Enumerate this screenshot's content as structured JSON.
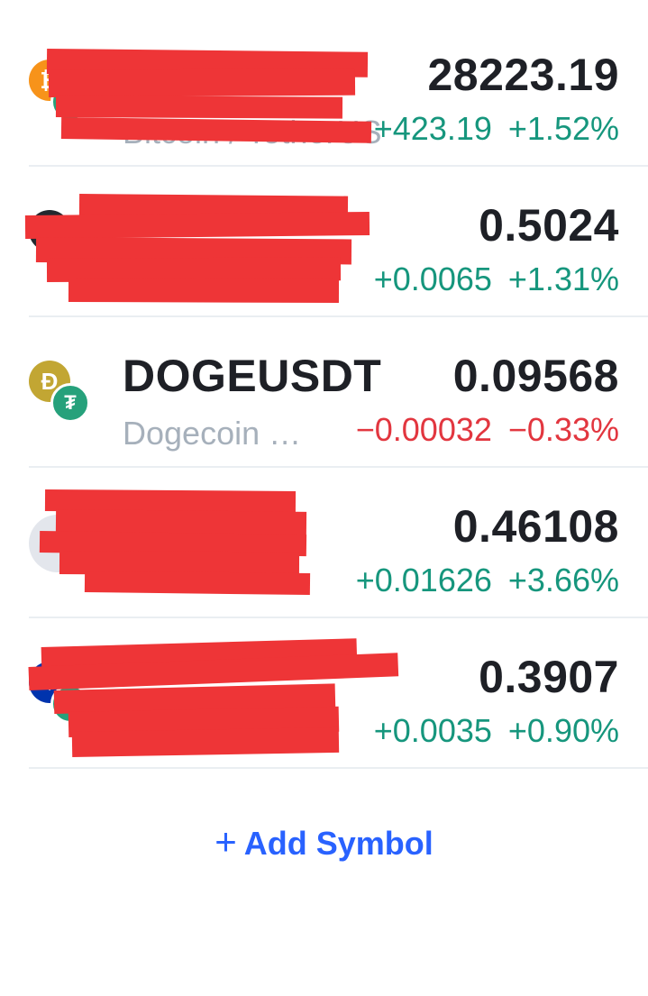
{
  "watchlist": [
    {
      "symbol": "",
      "description": "Bitcoin / TetherUS",
      "price": "28223.19",
      "change_abs": "+423.19",
      "change_pct": "+1.52%",
      "direction": "up",
      "base_icon": "bitcoin-icon",
      "base_color": "#f7931a",
      "quote_icon": "tether-icon",
      "quote_color": "#26a17b",
      "redacted": true
    },
    {
      "symbol": "",
      "description": "",
      "price": "0.5024",
      "change_abs": "+0.0065",
      "change_pct": "+1.31%",
      "direction": "up",
      "base_icon": "xrp-icon",
      "base_color": "#23292f",
      "quote_icon": "tether-icon",
      "quote_color": "#26a17b",
      "redacted": true
    },
    {
      "symbol": "DOGEUSDT",
      "description": "Dogecoin …",
      "price": "0.09568",
      "change_abs": "−0.00032",
      "change_pct": "−0.33%",
      "direction": "down",
      "base_icon": "dogecoin-icon",
      "base_glyph": "Ð",
      "base_color": "#c2a633",
      "quote_icon": "tether-icon",
      "quote_glyph": "₮",
      "quote_color": "#26a17b",
      "redacted": false
    },
    {
      "symbol": "",
      "description": "",
      "price": "0.46108",
      "change_abs": "+0.01626",
      "change_pct": "+3.66%",
      "direction": "up",
      "base_icon": "coin-placeholder-icon",
      "base_color": "#e3e6ec",
      "quote_icon": "",
      "quote_color": "",
      "redacted": true
    },
    {
      "symbol": "",
      "description": "",
      "price": "0.3907",
      "change_abs": "+0.0035",
      "change_pct": "+0.90%",
      "direction": "up",
      "base_icon": "cardano-icon",
      "base_color": "#0033ad",
      "quote_icon": "tether-icon",
      "quote_color": "#26a17b",
      "redacted": true
    }
  ],
  "add_symbol": {
    "plus": "+",
    "label": "Add Symbol"
  },
  "colors": {
    "up": "#16967d",
    "down": "#e2363f",
    "accent": "#2962ff",
    "redaction": "#ee3537"
  }
}
